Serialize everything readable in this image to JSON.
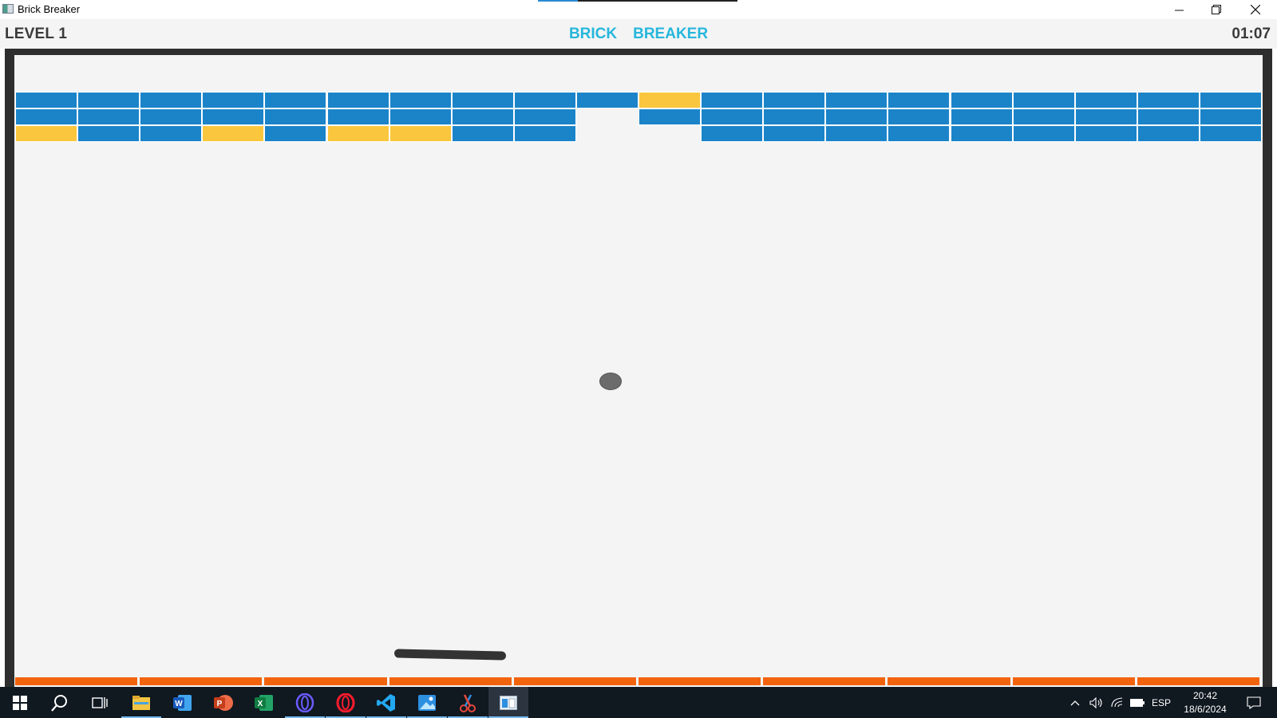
{
  "window": {
    "title": "Brick Breaker",
    "minimize": "—",
    "close": "✕"
  },
  "header": {
    "level": "LEVEL 1",
    "title_word1": "BRICK",
    "title_word2": "BREAKER",
    "timer": "01:07"
  },
  "colors": {
    "brick_blue": "#1b84c9",
    "brick_yellow": "#f9c63d",
    "title_cyan": "#26b7dc",
    "floor_orange": "#f2630e",
    "paddle": "#333333",
    "ball": "#6c6c6c"
  },
  "bricks": {
    "columns": 20,
    "rows": [
      [
        "b",
        "b",
        "b",
        "b",
        "b",
        "b",
        "b",
        "b",
        "b",
        "b",
        "y",
        "b",
        "b",
        "b",
        "b",
        "b",
        "b",
        "b",
        "b",
        "b"
      ],
      [
        "b",
        "b",
        "b",
        "b",
        "b",
        "b",
        "b",
        "b",
        "b",
        "",
        "b",
        "b",
        "b",
        "b",
        "b",
        "b",
        "b",
        "b",
        "b",
        "b"
      ],
      [
        "y",
        "b",
        "b",
        "y",
        "b",
        "y",
        "y",
        "b",
        "b",
        "",
        "",
        "b",
        "b",
        "b",
        "b",
        "b",
        "b",
        "b",
        "b",
        "b"
      ]
    ]
  },
  "floor_segments": 10,
  "taskbar": {
    "icons": [
      "windows-start-icon",
      "search-icon",
      "task-view-icon",
      "file-explorer-icon",
      "word-icon",
      "powerpoint-icon",
      "excel-icon",
      "opera-gx-icon",
      "opera-icon",
      "vscode-icon",
      "photos-icon",
      "snipping-tool-icon",
      "brick-breaker-app-icon"
    ],
    "language": "ESP",
    "time": "20:42",
    "date": "18/6/2024"
  }
}
